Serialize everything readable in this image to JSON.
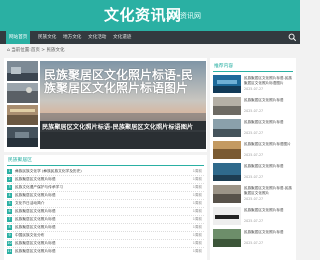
{
  "site": {
    "name": "文化资讯网",
    "sub": "文化资讯网"
  },
  "nav": [
    "网站首页",
    "民族文化",
    "地方文化",
    "文化活动",
    "文化遗迹"
  ],
  "breadcrumb": "当前位置:首页 > 民族文化",
  "hero": {
    "big": "民族聚居区文化照片标语-民族聚居区文化照片标语图片",
    "small": "民族聚居区文化照片标语-民族聚居区文化照片标语图片"
  },
  "side": {
    "title": "推荐内容",
    "items": [
      {
        "title": "民族聚居区文化照片标语-民族聚居区文化照片标语图片",
        "date": "2025-07-27"
      },
      {
        "title": "民族聚居区文化照片标语",
        "date": "2025-07-27"
      },
      {
        "title": "民族聚居区文化照片标语",
        "date": "2025-07-27"
      },
      {
        "title": "民族聚居区文化照片标语图片",
        "date": "2025-07-27"
      },
      {
        "title": "民族聚居区文化照片标语",
        "date": "2025-07-27"
      },
      {
        "title": "民族聚居区文化照片标语-民族聚居区文化照片",
        "date": "2025-07-27"
      },
      {
        "title": "民族聚居区文化照片标语",
        "date": "2025-07-27"
      },
      {
        "title": "民族聚居区文化照片标语",
        "date": "2025-07-27"
      }
    ]
  },
  "list": {
    "title": "民族聚居区",
    "rows": [
      {
        "n": "1",
        "title": "彝族民族文化学 (彝族民族文化学及历史)",
        "date": "1周前"
      },
      {
        "n": "2",
        "title": "民族聚居区文化照片标语",
        "date": "1周前"
      },
      {
        "n": "3",
        "title": "民族文化遗产保护与传承学习",
        "date": "1周前"
      },
      {
        "n": "4",
        "title": "民族聚居区文化照片标语",
        "date": "1周前"
      },
      {
        "n": "5",
        "title": "文化节日活动简介",
        "date": "1周前"
      },
      {
        "n": "6",
        "title": "民族聚居区文化照片标语",
        "date": "1周前"
      },
      {
        "n": "7",
        "title": "民族聚居区文化照片标语",
        "date": "1周前"
      },
      {
        "n": "8",
        "title": "民族聚居区文化照片标语",
        "date": "1周前"
      },
      {
        "n": "9",
        "title": "中国民族文化分布",
        "date": "1周前"
      },
      {
        "n": "10",
        "title": "民族聚居区文化照片标语",
        "date": "1周前"
      },
      {
        "n": "11",
        "title": "民族聚居区文化照片标语",
        "date": "1周前"
      },
      {
        "n": "12",
        "title": "民族聚居区文化照片标语",
        "date": "1周前"
      }
    ]
  }
}
